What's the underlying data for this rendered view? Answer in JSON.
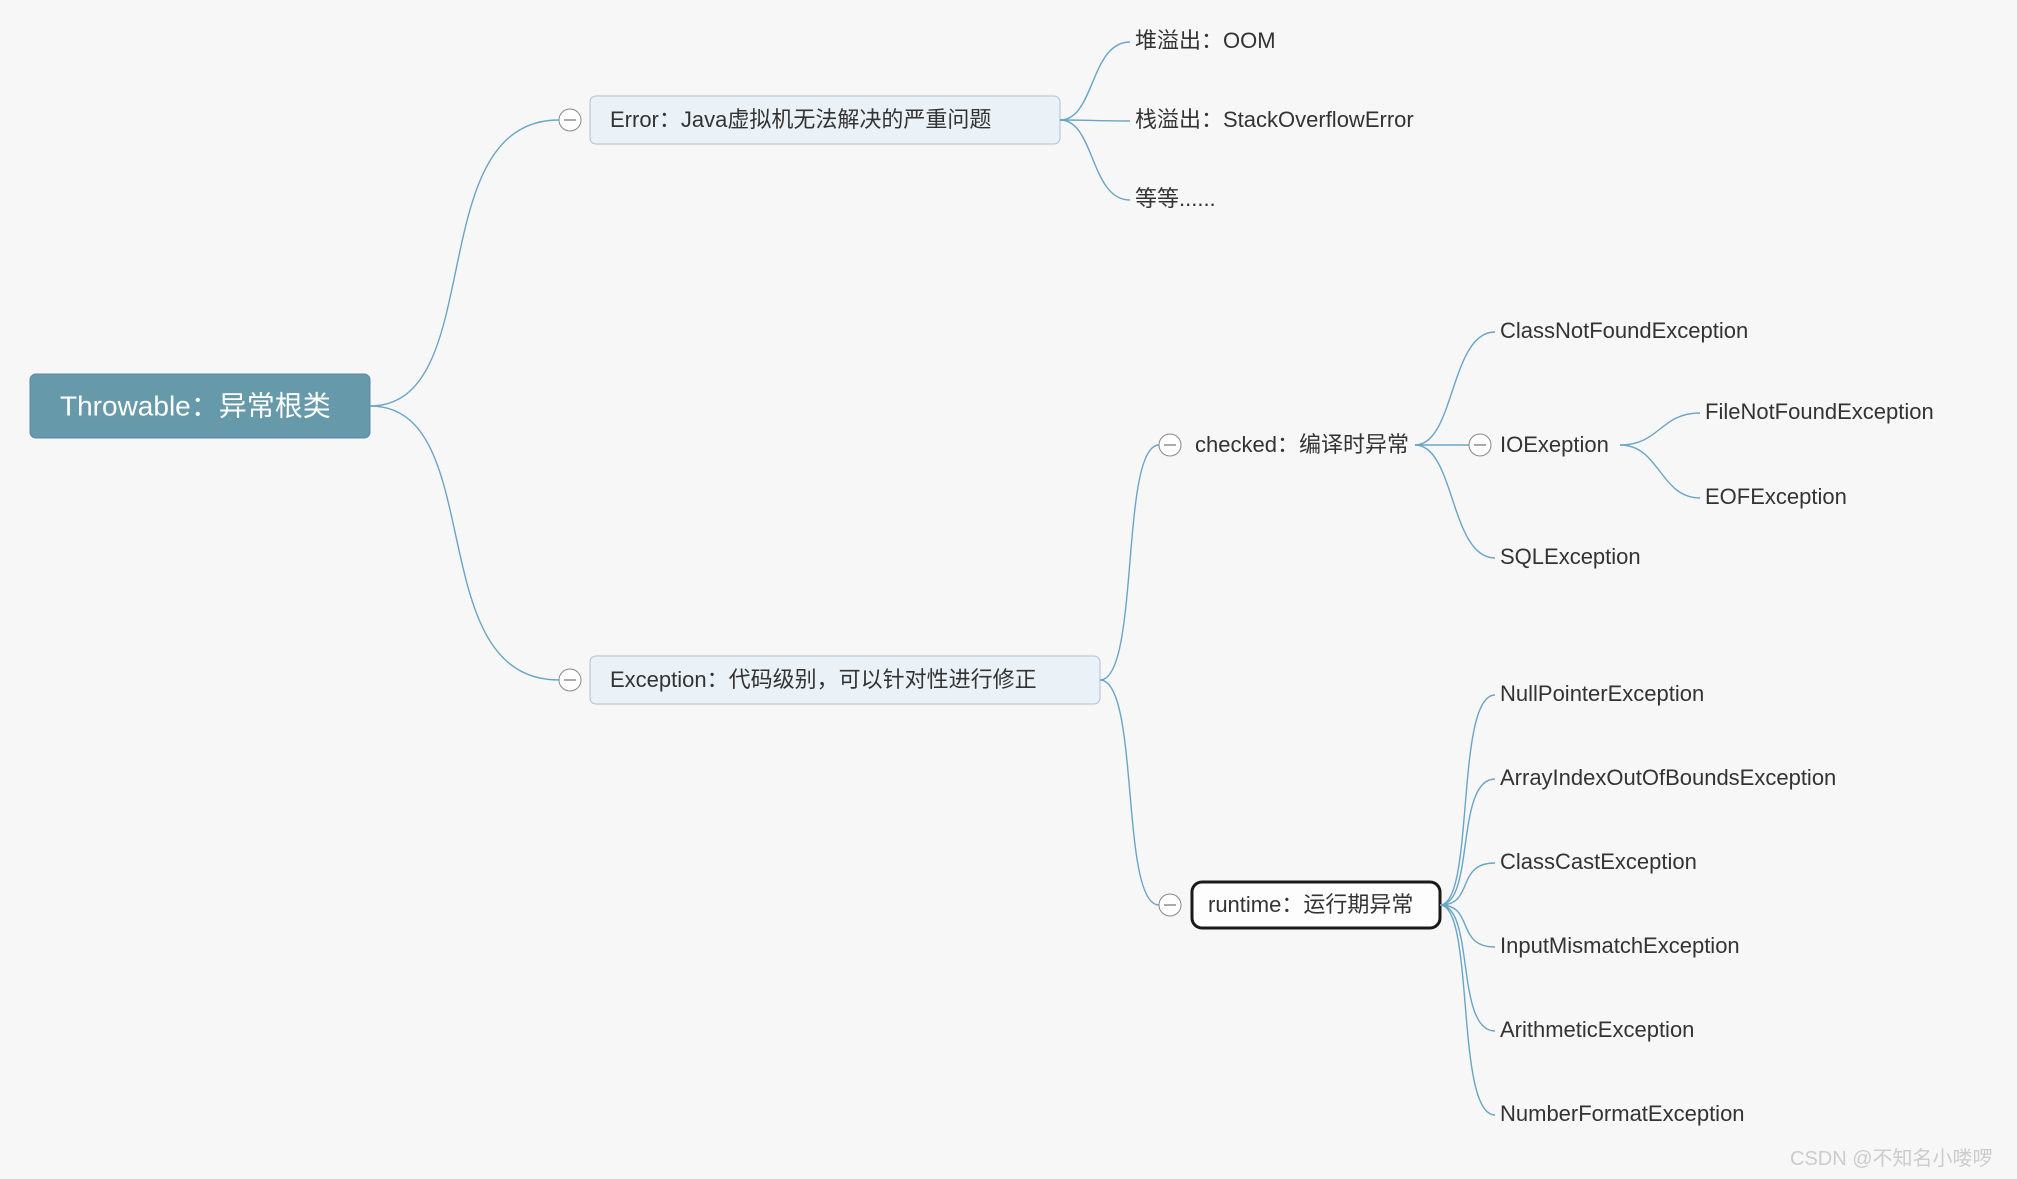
{
  "root": {
    "label": "Throwable：异常根类"
  },
  "error": {
    "label": "Error：Java虚拟机无法解决的严重问题",
    "children": [
      "堆溢出：OOM",
      "栈溢出：StackOverflowError",
      "等等......"
    ]
  },
  "exception": {
    "label": "Exception：代码级别，可以针对性进行修正",
    "checked": {
      "label": "checked：编译时异常",
      "children": [
        "ClassNotFoundException",
        "IOExeption",
        "SQLException"
      ],
      "io_children": [
        "FileNotFoundException",
        "EOFException"
      ]
    },
    "runtime": {
      "label": "runtime：运行期异常",
      "children": [
        "NullPointerException",
        "ArrayIndexOutOfBoundsException",
        "ClassCastException",
        "InputMismatchException",
        "ArithmeticException",
        "NumberFormatException"
      ]
    }
  },
  "watermark": "CSDN @不知名小喽啰"
}
